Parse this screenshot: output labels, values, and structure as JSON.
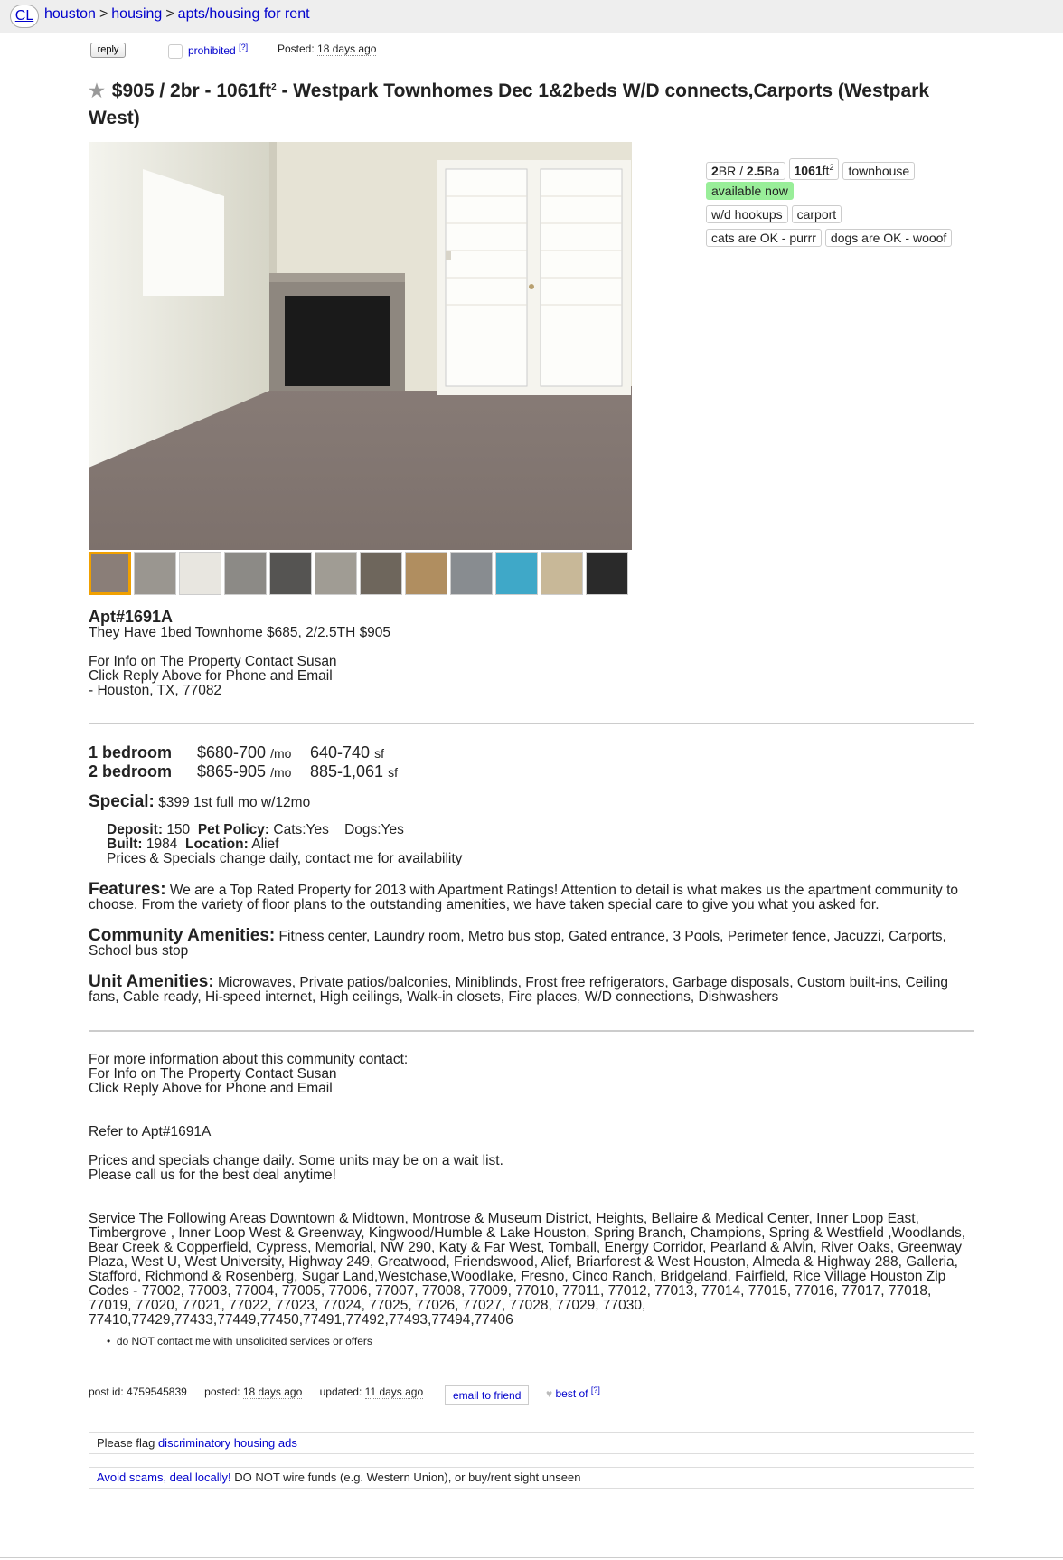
{
  "nav": {
    "logo": "CL",
    "crumbs": [
      "houston",
      "housing",
      "apts/housing for rent"
    ],
    "sep": ">"
  },
  "postinfo": {
    "reply": "reply",
    "prohibited": "prohibited",
    "help": "[?]",
    "posted_label": "Posted:",
    "posted_value": "18 days ago"
  },
  "title": {
    "price": "$905",
    "beds": "2br",
    "size": "1061ft",
    "size_sup": "2",
    "text": "- Westpark Townhomes Dec 1&2beds W/D connects,Carports",
    "location": "(Westpark West)"
  },
  "attrs": {
    "br": "2",
    "br_suffix": "BR /",
    "ba": "2.5",
    "ba_suffix": "Ba",
    "sqft": "1061",
    "sqft_unit": "ft",
    "sqft_sup": "2",
    "type": "townhouse",
    "available": "available now",
    "laundry": "w/d hookups",
    "parking": "carport",
    "cats": "cats are OK - purrr",
    "dogs": "dogs are OK - wooof"
  },
  "body": {
    "apt": "Apt#1691A",
    "line1": "They Have 1bed Townhome $685, 2/2.5TH $905",
    "contact1": "For Info on The Property Contact Susan",
    "contact2": "Click Reply Above for Phone and Email",
    "contact3": "- Houston, TX, 77082"
  },
  "pricing": [
    {
      "bed": "1 bedroom",
      "price": "$680-700",
      "per": "/mo",
      "sf": "640-740",
      "sf_unit": "sf"
    },
    {
      "bed": "2 bedroom",
      "price": "$865-905",
      "per": "/mo",
      "sf": "885-1,061",
      "sf_unit": "sf"
    }
  ],
  "special": {
    "label": "Special:",
    "value": "$399 1st full mo w/12mo"
  },
  "details": {
    "deposit_label": "Deposit:",
    "deposit": "150",
    "pet_label": "Pet Policy:",
    "pet": "Cats:Yes    Dogs:Yes",
    "built_label": "Built:",
    "built": "1984",
    "location_label": "Location:",
    "location": "Alief",
    "note": "Prices & Specials change daily, contact me for availability"
  },
  "features": {
    "label": "Features:",
    "text": "We are a Top Rated Property for 2013 with Apartment Ratings! Attention to detail is what makes us the apartment community to choose. From the variety of floor plans to the outstanding amenities, we have taken special care to give you what you asked for."
  },
  "community": {
    "label": "Community Amenities:",
    "text": "Fitness center, Laundry room, Metro bus stop, Gated entrance, 3 Pools, Perimeter fence, Jacuzzi, Carports, School bus stop"
  },
  "unit": {
    "label": "Unit Amenities:",
    "text": "Microwaves, Private patios/balconies, Miniblinds, Frost free refrigerators, Garbage disposals, Custom built-ins, Ceiling fans, Cable ready, Hi-speed internet, High ceilings, Walk-in closets, Fire places, W/D connections, Dishwashers"
  },
  "more": {
    "l1": "For more information about this community contact:",
    "l2": "For Info on The Property Contact Susan",
    "l3": "Click Reply Above for Phone and Email",
    "refer": "Refer to Apt#1691A",
    "p1": "Prices and specials change daily. Some units may be on a wait list.",
    "p2": "Please call us for the best deal anytime!",
    "areas": "Service The Following Areas Downtown & Midtown, Montrose & Museum District, Heights, Bellaire & Medical Center, Inner Loop East, Timbergrove , Inner Loop West & Greenway, Kingwood/Humble & Lake Houston, Spring Branch, Champions, Spring & Westfield ,Woodlands, Bear Creek & Copperfield, Cypress, Memorial, NW 290, Katy & Far West, Tomball, Energy Corridor, Pearland & Alvin, River Oaks, Greenway Plaza, West U, West University, Highway 249, Greatwood, Friendswood, Alief, Briarforest & West Houston, Almeda & Highway 288, Galleria, Stafford, Richmond & Rosenberg, Sugar Land,Westchase,Woodlake, Fresno, Cinco Ranch, Bridgeland, Fairfield, Rice Village Houston Zip Codes - 77002, 77003, 77004, 77005, 77006, 77007, 77008, 77009, 77010, 77011, 77012, 77013, 77014, 77015, 77016, 77017, 77018, 77019, 77020, 77021, 77022, 77023, 77024, 77025, 77026, 77027, 77028, 77029, 77030, 77410,77429,77433,77449,77450,77491,77492,77493,77494,77406"
  },
  "notice_item": "do NOT contact me with unsolicited services or offers",
  "footer": {
    "postid_label": "post id:",
    "postid": "4759545839",
    "posted_label": "posted:",
    "posted": "18 days ago",
    "updated_label": "updated:",
    "updated": "11 days ago",
    "email": "email to friend",
    "bestof": "best of",
    "help": "[?]"
  },
  "flag_notice": {
    "prefix": "Please flag",
    "link": "discriminatory housing ads"
  },
  "scam_notice": {
    "link": "Avoid scams, deal locally!",
    "text": "DO NOT wire funds (e.g. Western Union), or buy/rent sight unseen"
  },
  "colors": {
    "link": "#0000cc",
    "available": "#99ee99",
    "thumb_selected": "#f0a000"
  }
}
